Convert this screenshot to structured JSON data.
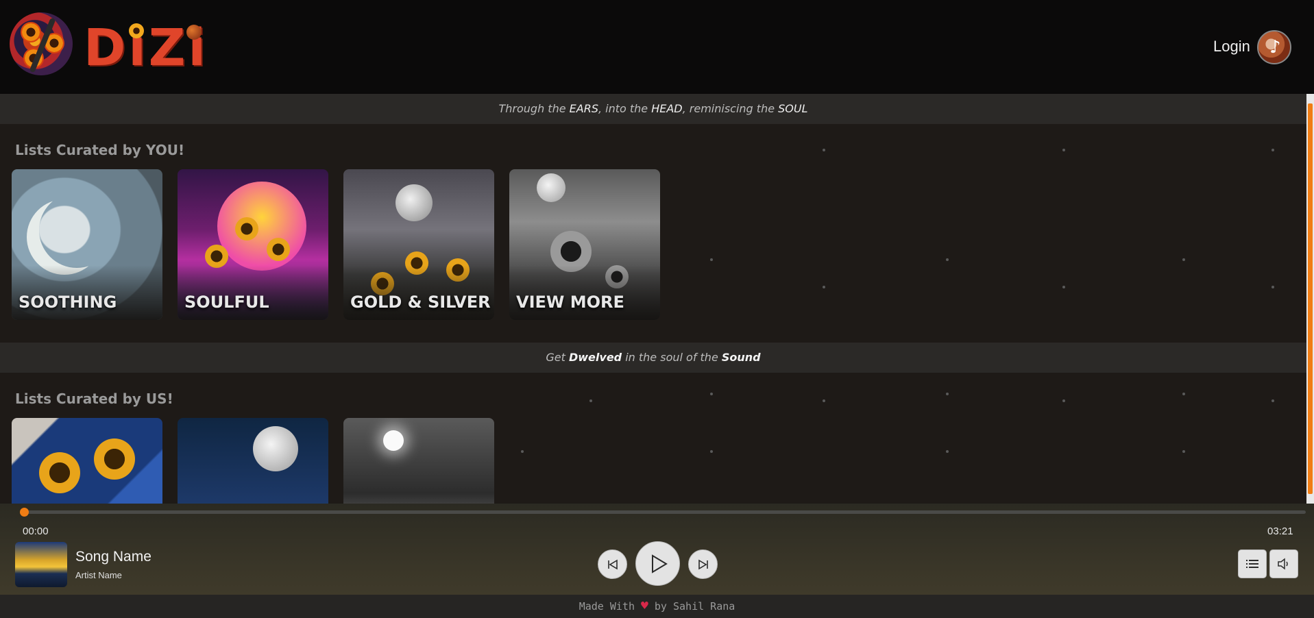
{
  "header": {
    "logo_text": "DiZi",
    "login_label": "Login"
  },
  "banners": {
    "top": {
      "p1": "Through the ",
      "w1": "EARS",
      "p2": ", into the ",
      "w2": "HEAD",
      "p3": ", reminiscing the ",
      "w3": "SOUL"
    },
    "middle": {
      "p1": "Get ",
      "w1": "Dwelved",
      "p2": " in the soul of the ",
      "w2": "Sound"
    }
  },
  "sections": {
    "you": {
      "title": "Lists Curated by YOU!",
      "cards": [
        {
          "label": "SOOTHING"
        },
        {
          "label": "SOULFUL"
        },
        {
          "label": "GOLD & SILVER"
        },
        {
          "label": "VIEW MORE"
        }
      ]
    },
    "us": {
      "title": "Lists Curated by US!",
      "cards": [
        {
          "label": ""
        },
        {
          "label": ""
        },
        {
          "label": ""
        }
      ]
    }
  },
  "player": {
    "progress": 0,
    "time_current": "00:00",
    "time_total": "03:21",
    "song_name": "Song Name",
    "artist_name": "Artist Name",
    "icons": {
      "prev": "skip-previous-icon",
      "play": "play-icon",
      "next": "skip-next-icon",
      "queue": "list-icon",
      "volume": "volume-icon"
    },
    "accent_color": "#f07d14"
  },
  "footer": {
    "pre": "Made With ",
    "heart": "♥",
    "post": " by Sahil Rana"
  }
}
